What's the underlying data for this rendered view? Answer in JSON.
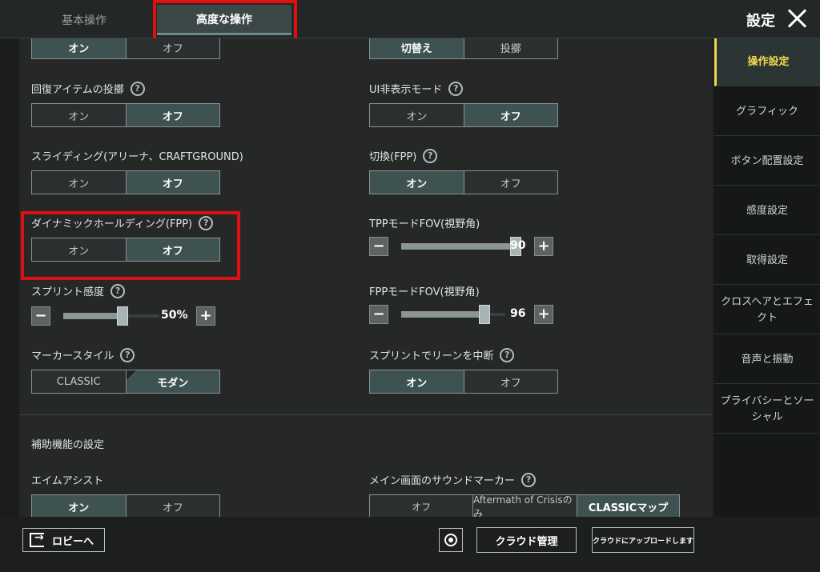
{
  "header": {
    "tabs": [
      {
        "label": "基本操作",
        "active": false
      },
      {
        "label": "高度な操作",
        "active": true
      }
    ],
    "title": "設定"
  },
  "sidebar": {
    "items": [
      {
        "label": "操作設定",
        "active": true
      },
      {
        "label": "グラフィック"
      },
      {
        "label": "ボタン配置設定"
      },
      {
        "label": "感度設定"
      },
      {
        "label": "取得設定"
      },
      {
        "label": "クロスヘアとエフェクト"
      },
      {
        "label": "音声と振動"
      },
      {
        "label": "プライバシーとソーシャル"
      }
    ]
  },
  "settings": {
    "top_cut_left": {
      "on": "オン",
      "off": "オフ"
    },
    "top_cut_right": {
      "a": "切替え",
      "b": "投擲"
    },
    "recovery_throw": {
      "label": "回復アイテムの投擲",
      "on": "オン",
      "off": "オフ",
      "selected": "off"
    },
    "ui_hide": {
      "label": "UI非表示モード",
      "on": "オン",
      "off": "オフ",
      "selected": "off"
    },
    "sliding": {
      "label": "スライディング(アリーナ、CRAFTGROUND)",
      "on": "オン",
      "off": "オフ",
      "selected": "off"
    },
    "switch_fpp": {
      "label": "切換(FPP)",
      "on": "オン",
      "off": "オフ",
      "selected": "on"
    },
    "dynamic_holding": {
      "label": "ダイナミックホールディング(FPP)",
      "on": "オン",
      "off": "オフ",
      "selected": "off"
    },
    "tpp_fov": {
      "label": "TPPモードFOV(視野角)",
      "value": "90",
      "level": 1.0
    },
    "sprint_sens": {
      "label": "スプリント感度",
      "value": "50%",
      "level": 0.5
    },
    "fpp_fov": {
      "label": "FPPモードFOV(視野角)",
      "value": "96",
      "level": 0.7
    },
    "marker_style": {
      "label": "マーカースタイル",
      "classic": "CLASSIC",
      "modern": "モダン",
      "selected": "modern"
    },
    "sprint_lean": {
      "label": "スプリントでリーンを中断",
      "on": "オン",
      "off": "オフ",
      "selected": "on"
    },
    "assist_section": "補助機能の設定",
    "aim_assist": {
      "label": "エイムアシスト",
      "on": "オン",
      "off": "オフ",
      "selected": "on"
    },
    "sound_marker": {
      "label": "メイン画面のサウンドマーカー",
      "off": "オフ",
      "aftermath": "Aftermath of Crisisのみ",
      "classic_map": "CLASSICマップ",
      "selected": "classic_map"
    }
  },
  "footer": {
    "lobby": "ロビーへ",
    "cloud": "クラウド管理",
    "upload": "クラウドにアップロードします"
  },
  "colors": {
    "accent": "#f2d84a",
    "selected": "#3f5252",
    "highlight": "#e01010"
  }
}
